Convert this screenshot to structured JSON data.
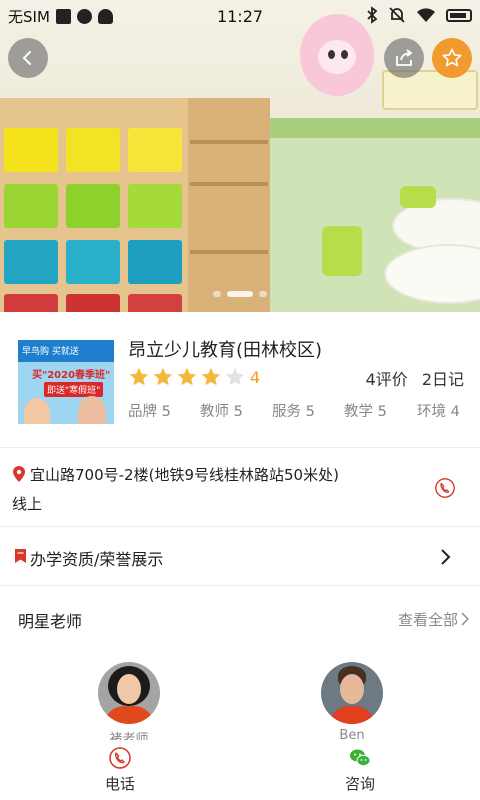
{
  "status_bar": {
    "carrier": "无SIM",
    "time": "11:27"
  },
  "school": {
    "name": "昂立少儿教育(田林校区)",
    "rating": 4,
    "rating_max": 5,
    "rating_text": "4",
    "reviews": "4评价",
    "diaries": "2日记",
    "scores": [
      {
        "label": "品牌 5"
      },
      {
        "label": "教师 5"
      },
      {
        "label": "服务 5"
      },
      {
        "label": "教学 5"
      },
      {
        "label": "环境 4"
      }
    ],
    "logo_text": {
      "top": "早鸟购 买就送",
      "middle": "买\"2020春季班\"",
      "bottom": "即送\"寒假班\""
    }
  },
  "carousel": {
    "slides": 3,
    "active_index": 1
  },
  "address": {
    "line1": "宜山路700号-2楼(地铁9号线桂林路站50米处)",
    "line2": "线上"
  },
  "honor": {
    "label": "办学资质/荣誉展示"
  },
  "teachers": {
    "title": "明星老师",
    "view_all": "查看全部",
    "list": [
      {
        "name": "褚老师"
      },
      {
        "name": "Ben"
      }
    ]
  },
  "bottom_bar": {
    "phone_label": "电话",
    "consult_label": "咨询"
  },
  "colors": {
    "accent": "#d9372a",
    "star": "#f4b93a",
    "fav": "#f29a2e",
    "wechat": "#3cb034"
  }
}
